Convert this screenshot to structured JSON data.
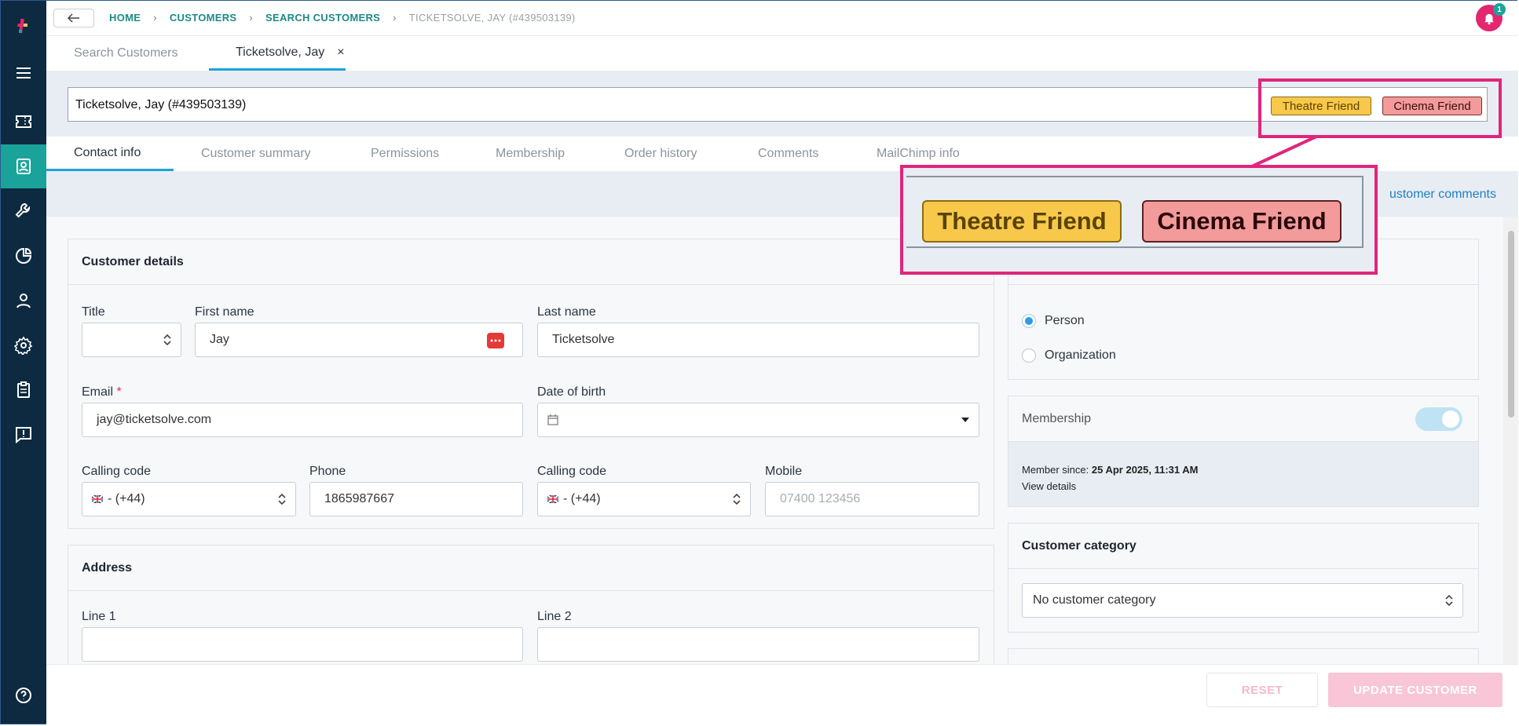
{
  "breadcrumbs": [
    "HOME",
    "CUSTOMERS",
    "SEARCH CUSTOMERS",
    "TICKETSOLVE, JAY (#439503139)"
  ],
  "notification_count": "1",
  "top_tabs": [
    "Search Customers",
    "Ticketsolve, Jay"
  ],
  "close_glyph": "×",
  "customer_title": "Ticketsolve, Jay (#439503139)",
  "tags": [
    "Theatre Friend",
    "Cinema Friend"
  ],
  "sub_tabs": [
    "Contact info",
    "Customer summary",
    "Permissions",
    "Membership",
    "Order history",
    "Comments",
    "MailChimp info"
  ],
  "view_comments": "ustomer comments",
  "customer_details": {
    "heading": "Customer details",
    "title_label": "Title",
    "title_value": "",
    "first_name_label": "First name",
    "first_name_value": "Jay",
    "last_name_label": "Last name",
    "last_name_value": "Ticketsolve",
    "email_label": "Email",
    "email_required": "*",
    "email_value": "jay@ticketsolve.com",
    "dob_label": "Date of birth",
    "dob_value": "",
    "calling_code_label": "Calling code",
    "calling_code_value": "- (+44)",
    "phone_label": "Phone",
    "phone_value": "1865987667",
    "calling_code2_label": "Calling code",
    "calling_code2_value": "- (+44)",
    "mobile_label": "Mobile",
    "mobile_placeholder": "07400 123456"
  },
  "address": {
    "heading": "Address",
    "line1_label": "Line 1",
    "line2_label": "Line 2"
  },
  "customer_type": {
    "options": [
      "Person",
      "Organization"
    ],
    "selected": "Person"
  },
  "membership": {
    "heading": "Membership",
    "enabled": true,
    "member_since_label": "Member since:",
    "member_since_value": "25 Apr 2025, 11:31 AM",
    "view_details": "View details"
  },
  "customer_category": {
    "heading": "Customer category",
    "value": "No customer category"
  },
  "footer": {
    "reset": "RESET",
    "update": "UPDATE CUSTOMER"
  },
  "colors": {
    "sidebar": "#0d2a40",
    "accent_teal": "#1aa39b",
    "highlight": "#e0257c",
    "theatre_tag": "#f7c84a",
    "cinema_tag": "#f39a9a"
  },
  "icons": [
    "logo-icon",
    "menu-icon",
    "ticket-icon",
    "contact-card-icon",
    "wrench-icon",
    "pie-chart-icon",
    "person-icon",
    "gear-icon",
    "clipboard-icon",
    "feedback-icon",
    "help-icon",
    "bell-icon",
    "back-arrow-icon",
    "calendar-icon"
  ]
}
